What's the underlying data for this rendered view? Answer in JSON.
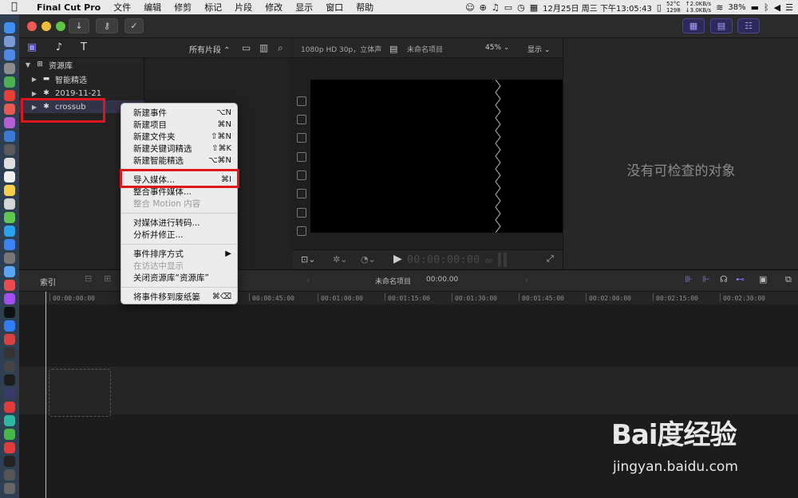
{
  "menubar": {
    "app": "Final Cut Pro",
    "items": [
      "文件",
      "编辑",
      "修剪",
      "标记",
      "片段",
      "修改",
      "显示",
      "窗口",
      "帮助"
    ],
    "temp": "52°C",
    "fan": "1298",
    "net_up": "↑2.0KB/s",
    "net_down": "↓3.0KB/s",
    "datetime": "12月25日 周三 下午13:05:43",
    "battery": "38%"
  },
  "browser": {
    "filter_label": "所有片段 ⌃",
    "library": {
      "root": "资源库",
      "items": [
        {
          "label": "智能精选"
        },
        {
          "label": "2019-11-21"
        },
        {
          "label": "crossub"
        }
      ]
    }
  },
  "viewer": {
    "format": "1080p HD 30p，立体声",
    "project": "未命名项目",
    "zoom": "45% ⌄",
    "display": "显示 ⌄",
    "timecode": "00:00:00:00",
    "timecode_frames": "00"
  },
  "inspector": {
    "empty_text": "没有可检查的对象"
  },
  "timeline": {
    "index_label": "索引",
    "project_name": "未命名项目",
    "project_timecode": "00:00.00",
    "ruler": [
      "00:00:00:00",
      "00:00:45:00",
      "00:01:00:00",
      "00:01:15:00",
      "00:01:30:00",
      "00:01:45:00",
      "00:02:00:00",
      "00:02:15:00",
      "00:02:30:00"
    ]
  },
  "context_menu": {
    "items": [
      {
        "label": "新建事件",
        "shortcut": "⌥N",
        "disabled": false
      },
      {
        "label": "新建项目",
        "shortcut": "⌘N",
        "disabled": false
      },
      {
        "label": "新建文件夹",
        "shortcut": "⇧⌘N",
        "disabled": false
      },
      {
        "label": "新建关键词精选",
        "shortcut": "⇧⌘K",
        "disabled": false
      },
      {
        "label": "新建智能精选",
        "shortcut": "⌥⌘N",
        "disabled": false
      },
      {
        "label": "导入媒体...",
        "shortcut": "⌘I",
        "disabled": false
      },
      {
        "label": "整合事件媒体...",
        "shortcut": "",
        "disabled": false
      },
      {
        "label": "整合 Motion 内容",
        "shortcut": "",
        "disabled": true
      },
      {
        "label": "对媒体进行转码...",
        "shortcut": "",
        "disabled": false
      },
      {
        "label": "分析并修正...",
        "shortcut": "",
        "disabled": false
      },
      {
        "label": "事件排序方式",
        "shortcut": "▶",
        "disabled": false
      },
      {
        "label": "在访达中显示",
        "shortcut": "",
        "disabled": true
      },
      {
        "label": "关闭资源库“资源库”",
        "shortcut": "",
        "disabled": false
      },
      {
        "label": "将事件移到废纸篓",
        "shortcut": "⌘⌫",
        "disabled": false
      }
    ]
  },
  "watermark": {
    "logo": "Bai度经验",
    "url": "jingyan.baidu.com"
  },
  "colors": {
    "accent": "#8a82ff",
    "annotation_red": "#e0151b"
  }
}
